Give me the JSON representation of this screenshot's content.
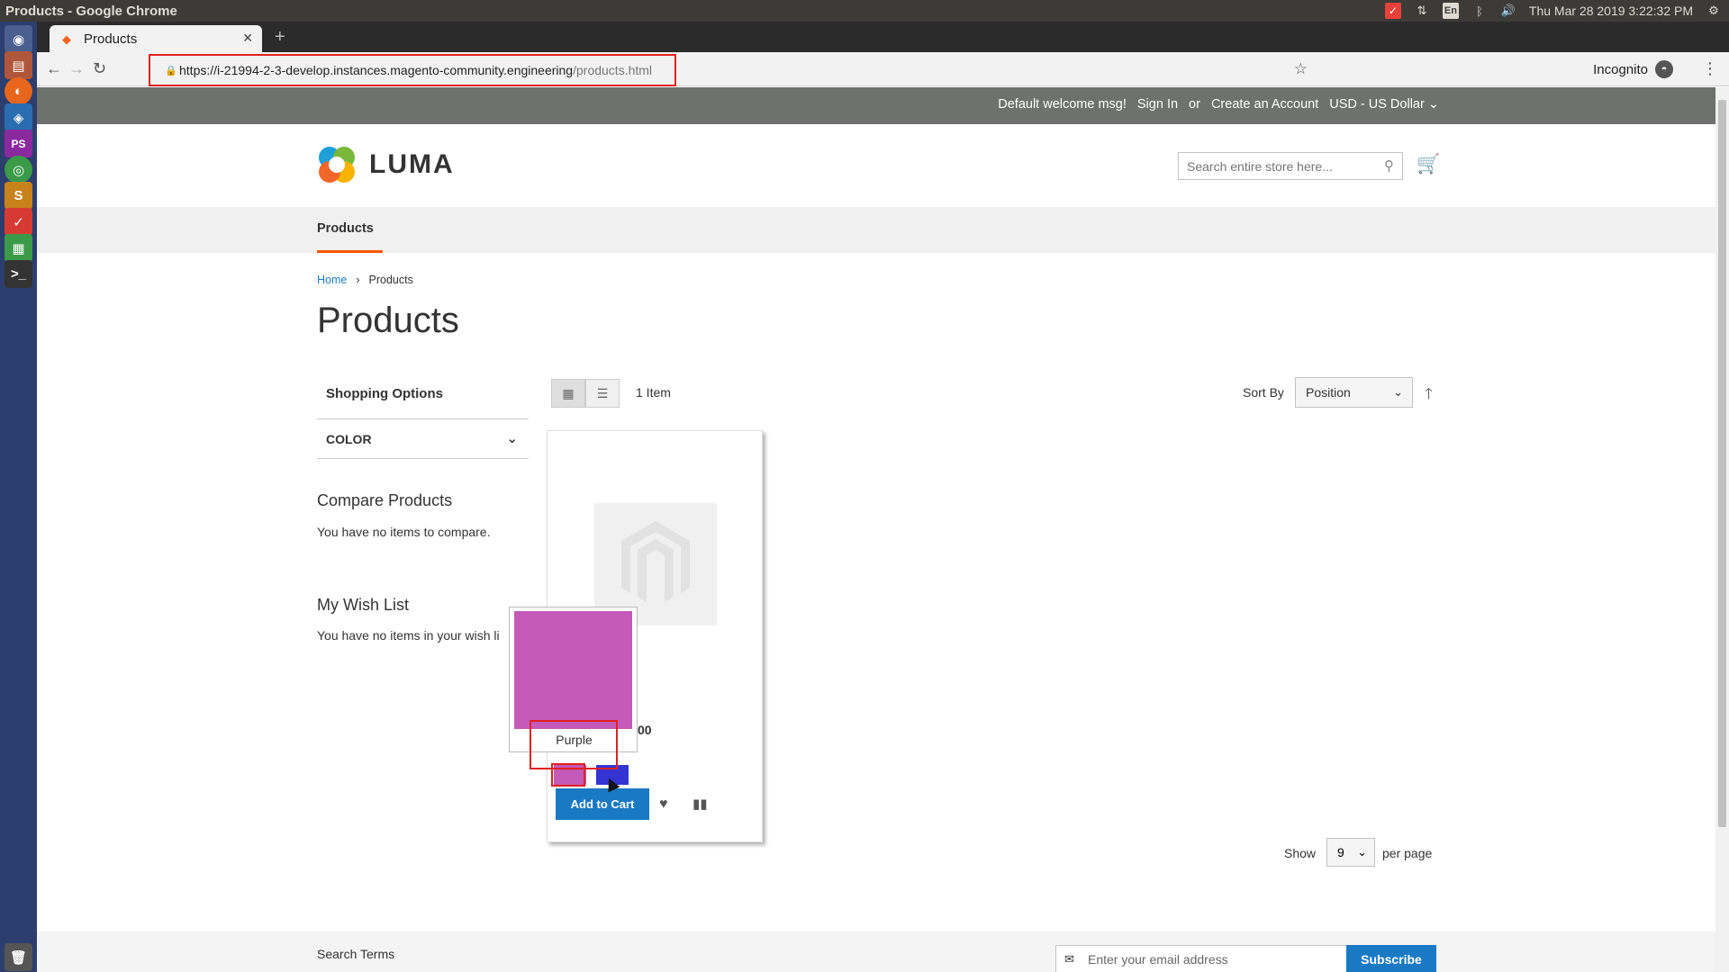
{
  "os": {
    "window_title": "Products - Google Chrome",
    "clock": "Thu Mar 28 2019  3:22:32 PM",
    "keyboard_layout": "En"
  },
  "browser": {
    "tab_title": "Products",
    "url_host": "https://i-21994-2-3-develop.instances.magento-community.engineering",
    "url_path": "/products.html",
    "incognito_label": "Incognito"
  },
  "store": {
    "header_links": {
      "welcome": "Default welcome msg!",
      "sign_in": "Sign In",
      "or": "or",
      "create_account": "Create an Account",
      "currency": "USD - US Dollar"
    },
    "logo_text": "LUMA",
    "search_placeholder": "Search entire store here...",
    "nav_item": "Products",
    "breadcrumb": {
      "home": "Home",
      "current": "Products"
    },
    "page_title": "Products"
  },
  "sidebar": {
    "shopping_options": "Shopping Options",
    "filter_color": "COLOR",
    "compare_title": "Compare Products",
    "compare_text": "You have no items to compare.",
    "wishlist_title": "My Wish List",
    "wishlist_text": "You have no items in your wish li"
  },
  "toolbar": {
    "item_count": "1 Item",
    "sort_label": "Sort By",
    "sort_value": "Position",
    "show_label": "Show",
    "show_value": "9",
    "per_page": "per page"
  },
  "product": {
    "price_fragment": "00",
    "add_to_cart": "Add to Cart",
    "swatches": [
      {
        "label": "Purple",
        "color": "#c45ab8"
      },
      {
        "label": "Blue",
        "color": "#3434d3"
      }
    ],
    "tooltip_label": "Purple"
  },
  "footer": {
    "search_terms": "Search Terms",
    "newsletter_placeholder": "Enter your email address",
    "subscribe": "Subscribe"
  },
  "colors": {
    "accent_blue": "#1979c3",
    "nav_underline": "#ff5501",
    "annotation_red": "#e02020"
  }
}
